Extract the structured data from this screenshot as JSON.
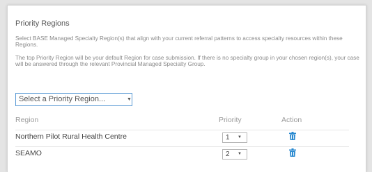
{
  "section": {
    "title": "Priority Regions",
    "description_1": "Select BASE Managed Specialty Region(s) that align with your current referral patterns to access specialty resources within these Regions.",
    "description_2": "The top Priority Region will be your default Region for case submission. If there is no specialty group in your chosen region(s), your case will be answered through the relevant Provincial Managed Specialty Group."
  },
  "region_select": {
    "selected": "Select a Priority Region..."
  },
  "table": {
    "headers": {
      "region": "Region",
      "priority": "Priority",
      "action": "Action"
    },
    "rows": [
      {
        "region": "Northern Pilot Rural Health Centre",
        "priority": "1"
      },
      {
        "region": "SEAMO",
        "priority": "2"
      }
    ]
  },
  "icons": {
    "dropdown": "chevron-down-icon",
    "delete": "trash-icon"
  },
  "colors": {
    "accent": "#2b8ad0",
    "select_border": "#5b9bd5"
  }
}
